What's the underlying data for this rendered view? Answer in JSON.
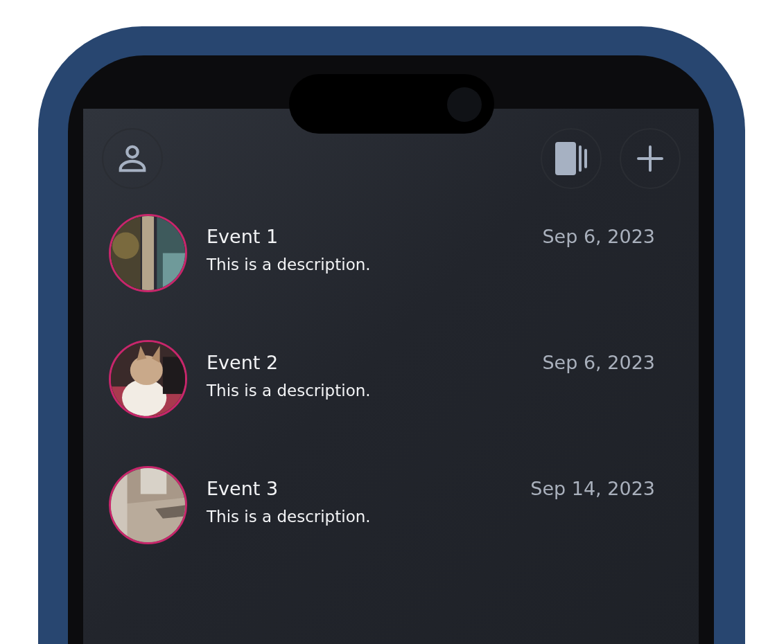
{
  "events": [
    {
      "title": "Event 1",
      "description": "This is a description.",
      "date": "Sep 6, 2023"
    },
    {
      "title": "Event 2",
      "description": "This is a description.",
      "date": "Sep 6, 2023"
    },
    {
      "title": "Event 3",
      "description": "This is a description.",
      "date": "Sep 14, 2023"
    }
  ]
}
